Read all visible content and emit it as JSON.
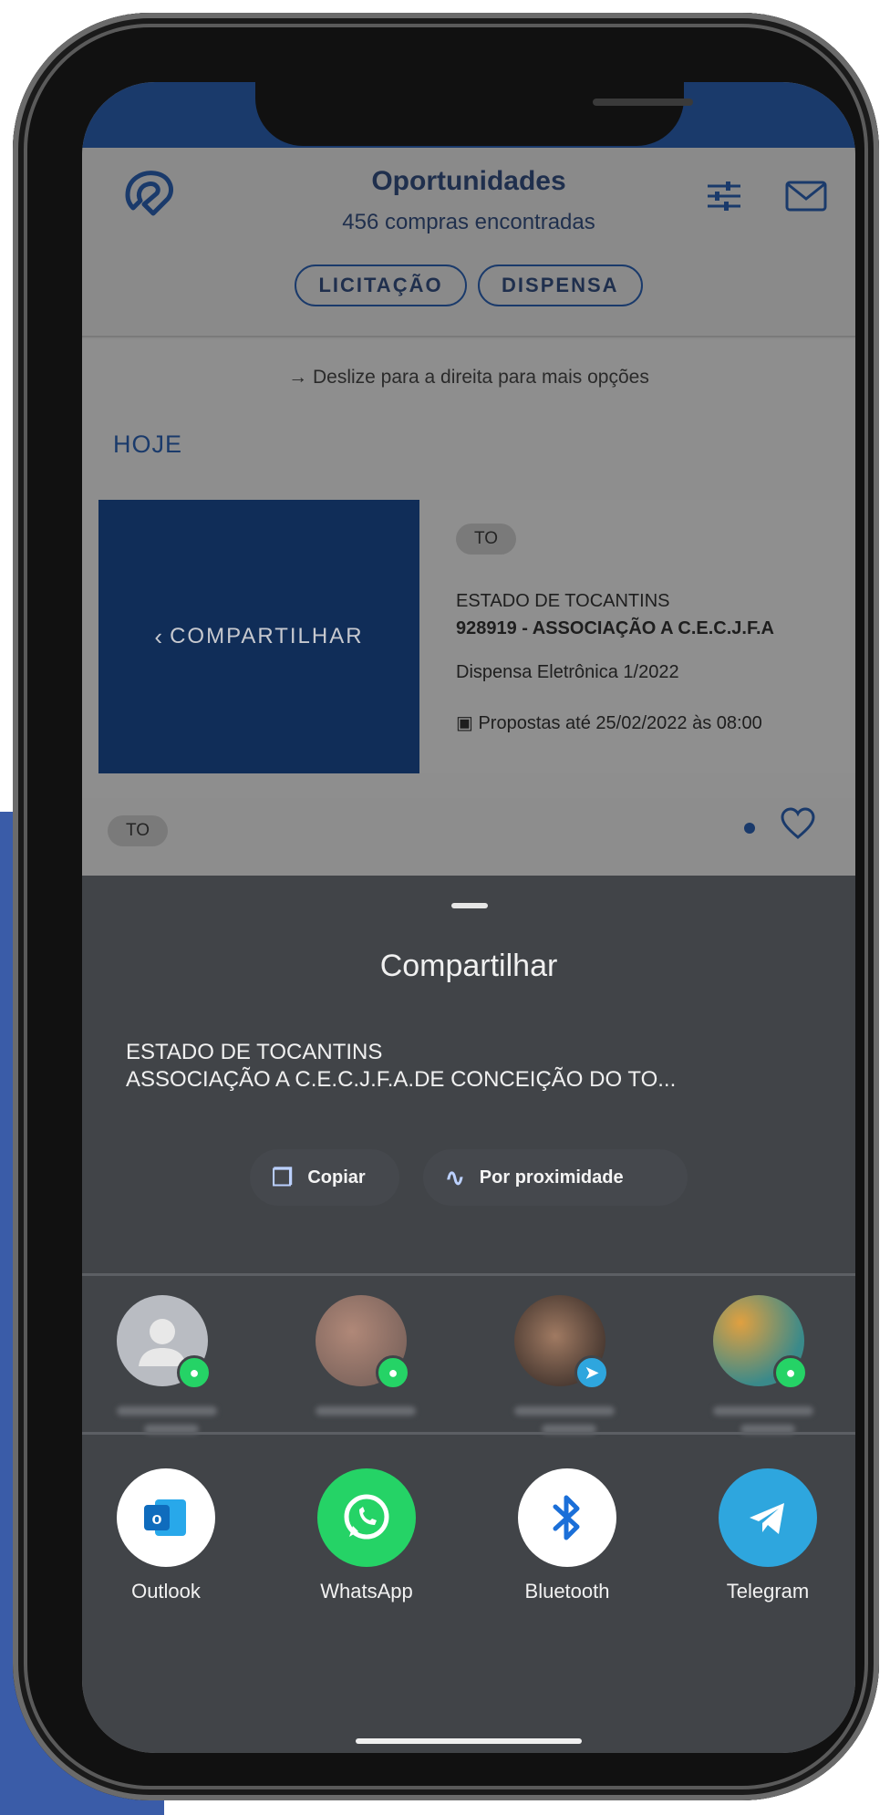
{
  "header": {
    "title": "Oportunidades",
    "subtitle": "456 compras encontradas",
    "pills": [
      "LICITAÇÃO",
      "DISPENSA"
    ]
  },
  "hint": "→ Deslize para a direita para mais opções",
  "section_label": "HOJE",
  "card": {
    "share_label": "COMPARTILHAR",
    "tag": "TO",
    "line1": "ESTADO DE TOCANTINS",
    "line2": "928919 - ASSOCIAÇÃO A C.E.C.J.F.A",
    "line3": "Dispensa Eletrônica 1/2022",
    "line4": "Propostas até 25/02/2022 às 08:00"
  },
  "row2": {
    "tag": "TO"
  },
  "share_sheet": {
    "title": "Compartilhar",
    "text_line1": "ESTADO DE TOCANTINS",
    "text_line2": "ASSOCIAÇÃO A C.E.C.J.F.A.DE CONCEIÇÃO DO TO...",
    "copy_label": "Copiar",
    "nearby_label": "Por proximidade",
    "apps": [
      "Outlook",
      "WhatsApp",
      "Bluetooth",
      "Telegram"
    ]
  },
  "colors": {
    "brand_navy": "#1a3a6b",
    "sheet_bg": "#414448",
    "whatsapp": "#25d366",
    "telegram": "#2ea6de",
    "outlook": "#0f6cbd",
    "bluetooth": "#1b6fd8"
  }
}
